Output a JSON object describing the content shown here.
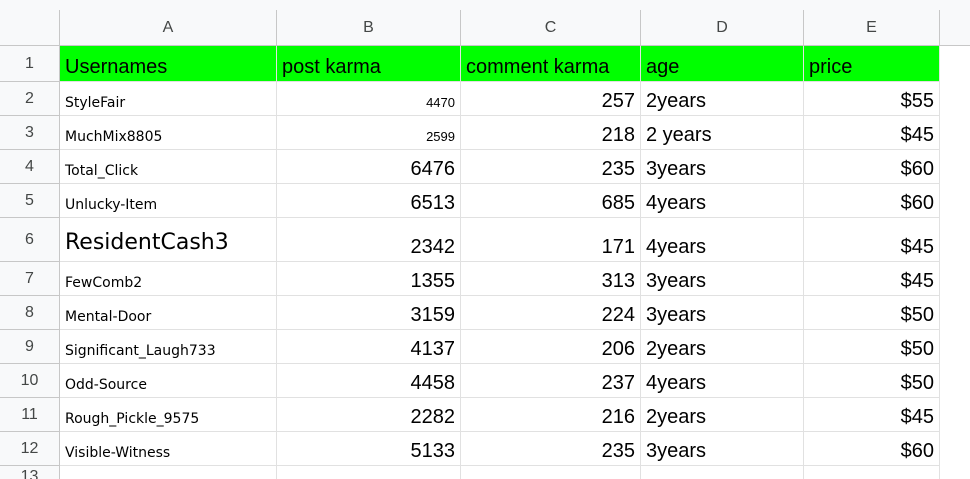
{
  "columns": [
    "A",
    "B",
    "C",
    "D",
    "E"
  ],
  "row_numbers": [
    "1",
    "2",
    "3",
    "4",
    "5",
    "6",
    "7",
    "8",
    "9",
    "10",
    "11",
    "12",
    "13"
  ],
  "header": {
    "usernames": "Usernames",
    "post_karma": "post karma",
    "comment_karma": "comment karma",
    "age": "age",
    "price": "price"
  },
  "rows": [
    {
      "username": "StyleFair",
      "post_karma": "4470",
      "comment_karma": "257",
      "age": "2years",
      "price": "$55"
    },
    {
      "username": "MuchMix8805",
      "post_karma": "2599",
      "comment_karma": "218",
      "age": "2 years",
      "price": "$45"
    },
    {
      "username": "Total_Click",
      "post_karma": "6476",
      "comment_karma": "235",
      "age": "3years",
      "price": "$60"
    },
    {
      "username": "Unlucky-Item",
      "post_karma": "6513",
      "comment_karma": "685",
      "age": "4years",
      "price": "$60"
    },
    {
      "username": "ResidentCash3",
      "post_karma": "2342",
      "comment_karma": "171",
      "age": "4years",
      "price": "$45"
    },
    {
      "username": "FewComb2",
      "post_karma": "1355",
      "comment_karma": "313",
      "age": "3years",
      "price": "$45"
    },
    {
      "username": "Mental-Door",
      "post_karma": "3159",
      "comment_karma": "224",
      "age": "3years",
      "price": "$50"
    },
    {
      "username": "Significant_Laugh733",
      "post_karma": "4137",
      "comment_karma": "206",
      "age": "2years",
      "price": "$50"
    },
    {
      "username": "Odd-Source",
      "post_karma": "4458",
      "comment_karma": "237",
      "age": "4years",
      "price": "$50"
    },
    {
      "username": "Rough_Pickle_9575",
      "post_karma": "2282",
      "comment_karma": "216",
      "age": "2years",
      "price": "$45"
    },
    {
      "username": "Visible-Witness",
      "post_karma": "5133",
      "comment_karma": "235",
      "age": "3years",
      "price": "$60"
    }
  ],
  "colors": {
    "header_fill": "#00ff00",
    "gridline": "#e1e1e1",
    "heading_bg": "#f8f9fa"
  }
}
